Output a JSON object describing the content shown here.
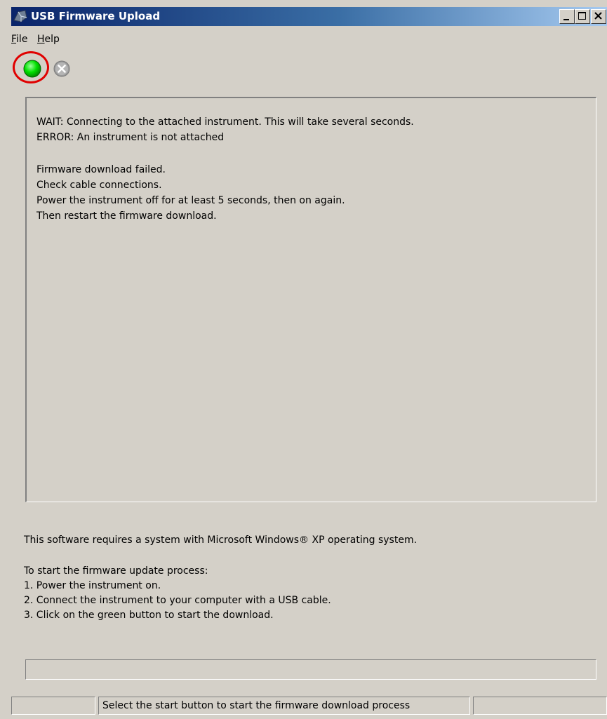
{
  "window": {
    "title": "USB Firmware Upload",
    "title_buttons": [
      "minimize-icon",
      "maximize-icon",
      "close-icon"
    ]
  },
  "menu": {
    "items": [
      {
        "label": "File",
        "mnemonic": "F"
      },
      {
        "label": "Help",
        "mnemonic": "H"
      }
    ]
  },
  "toolbar": {
    "start_icon": "green-circle-icon",
    "stop_icon": "gray-stop-icon",
    "start_color": "#00e000",
    "highlight_color": "#e00000"
  },
  "log": {
    "lines": [
      "WAIT: Connecting to the attached instrument. This will take several seconds.",
      "ERROR: An instrument is not attached",
      "",
      "Firmware download failed.",
      "Check cable connections.",
      "Power the instrument off for at least 5 seconds, then on again.",
      "Then restart the firmware download."
    ]
  },
  "info": {
    "requirement": "This software requires a system with Microsoft Windows® XP operating system.",
    "instructions_header": "To start the firmware update process:",
    "steps": [
      "1. Power the instrument on.",
      "2. Connect the instrument to your computer with a USB cable.",
      "3. Click on the green button to start the download."
    ]
  },
  "progress": {
    "value": 0
  },
  "statusbar": {
    "left": "",
    "message": "Select the start button to start the firmware download process",
    "right": ""
  }
}
